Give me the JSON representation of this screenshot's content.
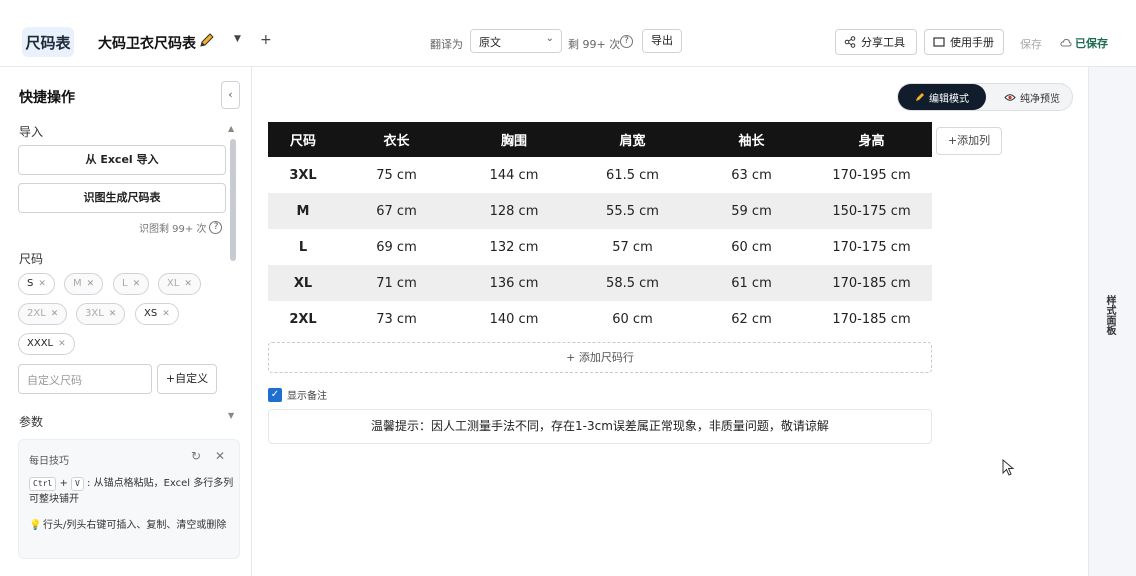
{
  "header": {
    "logo": "尺码表",
    "doc_title": "大码卫衣尺码表",
    "add_tab": "+",
    "translate_label": "翻译为",
    "language_selected": "原文",
    "remaining": "剩 99+ 次",
    "help": "?",
    "export_label": "导出",
    "share_label": "分享工具",
    "manual_label": "使用手册",
    "save_label": "保存",
    "saved_label": "已保存"
  },
  "sidebar": {
    "title": "快捷操作",
    "collapse": "‹",
    "import_label": "导入",
    "excel_import": "从 Excel 导入",
    "ocr_generate": "识图生成尺码表",
    "ocr_remaining": "识图剩 99+ 次",
    "sizes_label": "尺码",
    "chips": [
      {
        "label": "S",
        "active": true
      },
      {
        "label": "M",
        "active": false
      },
      {
        "label": "L",
        "active": false
      },
      {
        "label": "XL",
        "active": false
      },
      {
        "label": "2XL",
        "active": false
      },
      {
        "label": "3XL",
        "active": false
      },
      {
        "label": "XS",
        "active": true
      },
      {
        "label": "XXXL",
        "active": true
      }
    ],
    "custom_placeholder": "自定义尺码",
    "custom_button": "+自定义",
    "params_label": "参数",
    "tip": {
      "title": "每日技巧",
      "key1": "Ctrl",
      "plus": "+",
      "key2": "V",
      "line1": ": 从锚点格粘贴，Excel 多行多列可整块铺开",
      "line2": "行头/列头右键可插入、复制、清空或删除"
    }
  },
  "main": {
    "mode_edit": "编辑模式",
    "mode_preview": "纯净预览",
    "table": {
      "headers": [
        "尺码",
        "衣长",
        "胸围",
        "肩宽",
        "袖长",
        "身高"
      ],
      "rows": [
        [
          "3XL",
          "75 cm",
          "144 cm",
          "61.5 cm",
          "63 cm",
          "170-195 cm"
        ],
        [
          "M",
          "67 cm",
          "128 cm",
          "55.5 cm",
          "59 cm",
          "150-175 cm"
        ],
        [
          "L",
          "69 cm",
          "132 cm",
          "57 cm",
          "60 cm",
          "170-175 cm"
        ],
        [
          "XL",
          "71 cm",
          "136 cm",
          "58.5 cm",
          "61 cm",
          "170-185 cm"
        ],
        [
          "2XL",
          "73 cm",
          "140 cm",
          "60 cm",
          "62 cm",
          "170-185 cm"
        ]
      ]
    },
    "add_column": "+添加列",
    "add_row": "+ 添加尺码行",
    "show_notes": "显示备注",
    "notes": "温馨提示：因人工测量手法不同，存在1-3cm误差属正常现象，非质量问题，敬请谅解"
  },
  "right_panel": {
    "label": "样式面板"
  },
  "colors": {
    "accent": "#1f6fd1",
    "table_header": "#141414",
    "saved": "#1d6b52"
  }
}
